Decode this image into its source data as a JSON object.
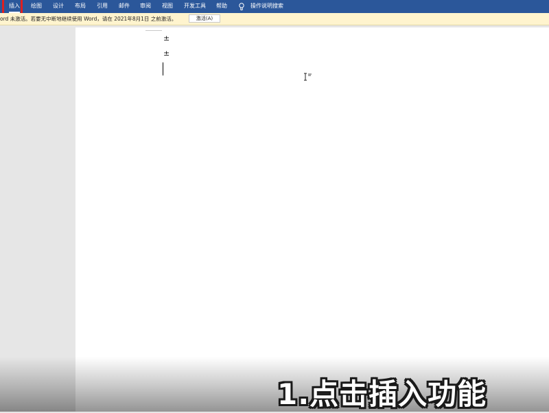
{
  "ribbon": {
    "tabs": [
      {
        "label": "插入",
        "active": true
      },
      {
        "label": "绘图"
      },
      {
        "label": "设计"
      },
      {
        "label": "布局"
      },
      {
        "label": "引用"
      },
      {
        "label": "邮件"
      },
      {
        "label": "审阅"
      },
      {
        "label": "视图"
      },
      {
        "label": "开发工具"
      },
      {
        "label": "帮助"
      }
    ],
    "search_label": "操作说明搜索",
    "bulb_icon": "lightbulb-icon",
    "color": "#2b579a"
  },
  "notice": {
    "text": "ord 未激活。若要无中断地继续使用 Word，请在 2021年8月1日 之前激活。",
    "button_label": "激活(A)",
    "color": "#fff4ce"
  },
  "document": {
    "paragraph_marks": [
      "±",
      "±"
    ]
  },
  "caption": {
    "text": "1.点击插入功能"
  }
}
